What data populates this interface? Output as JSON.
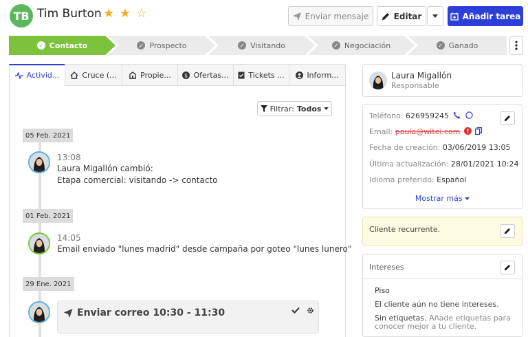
{
  "header": {
    "initials": "TB",
    "name": "Tim Burton",
    "stars": "★ ★ ☆",
    "send_label": "Enviar mensaje",
    "edit_label": "Editar",
    "task_label": "Añadir tarea"
  },
  "pipeline": {
    "stages": [
      "Contacto",
      "Prospecto",
      "Visitando",
      "Negociación",
      "Ganado"
    ],
    "active": "Contacto"
  },
  "tabs": [
    "Activid...",
    "Cruce (...",
    "Propie...",
    "Ofertas...",
    "Tickets ...",
    "Inform..."
  ],
  "activity": {
    "filter_label": "Filtrar:",
    "filter_value": "Todos",
    "entries": [
      {
        "date": "05 Feb. 2021",
        "time": "13:08",
        "line1": "Laura Migallón cambió:",
        "line2": "Etapa comercial: visitando -> contacto"
      },
      {
        "date": "01 Feb. 2021",
        "time": "14:05",
        "line1": "Email enviado \"lunes madrid\" desde campaña por goteo \"lunes lunero\""
      },
      {
        "date": "29 Ene. 2021",
        "task": "Enviar correo 10:30 - 11:30"
      }
    ]
  },
  "responsible": {
    "name": "Laura Migallón",
    "role": "Responsable"
  },
  "info": {
    "phone_label": "Teléfono:",
    "phone": "626959245",
    "email_label": "Email:",
    "email": "paula@witei.com",
    "created_label": "Fecha de creación:",
    "created": "03/06/2019 13:05",
    "updated_label": "Última actualización:",
    "updated": "28/01/2021 10:24",
    "lang_label": "Idioma preferido:",
    "lang": "Español",
    "more": "Mostrar más"
  },
  "note": "Cliente recurrente.",
  "interests": {
    "title": "Intereses",
    "type": "Piso",
    "empty": "El cliente aún no tiene intereses.",
    "no_tags": "Sin etiquetas.",
    "tags_hint": "Añade etiquetas para conocer mejor a tu cliente."
  },
  "colors": {
    "primary": "#2c3fd8",
    "stage_active": "#7cc23a",
    "avatar_initials": "#5cb85c",
    "star": "#f0ad28"
  }
}
